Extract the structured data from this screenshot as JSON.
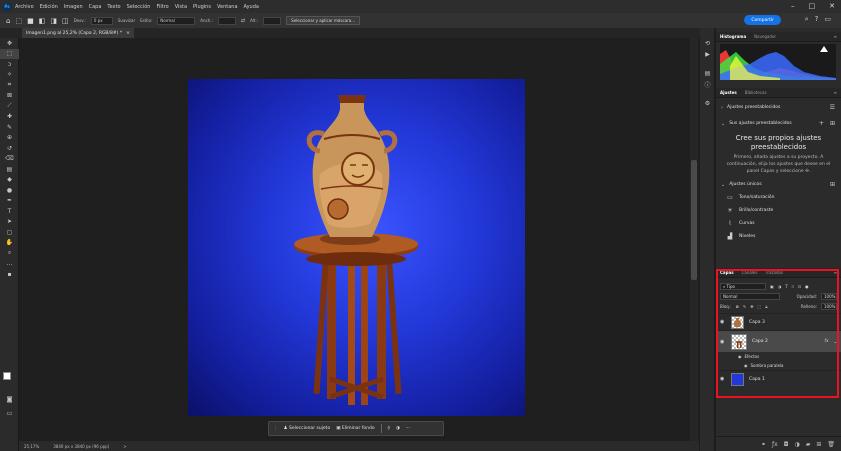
{
  "menubar": {
    "app_logo": "Ps",
    "items": [
      "Archivo",
      "Edición",
      "Imagen",
      "Capa",
      "Texto",
      "Selección",
      "Filtro",
      "Vista",
      "Plugins",
      "Ventana",
      "Ayuda"
    ],
    "window_controls": [
      "–",
      "□",
      "✕"
    ]
  },
  "optionsbar": {
    "feather_label": "Desv.:",
    "feather_value": "0 px",
    "smooth_label": "Suavizar",
    "style_label": "Estilo:",
    "style_value": "Normal",
    "width_label": "Anch.:",
    "height_label": "Alt.:",
    "select_mask_button": "Seleccionar y aplicar máscara...",
    "share_button": "Compartir"
  },
  "document": {
    "tab_title": "Imagen1.png al 25,2% (Capa 2, RGB/8#) *",
    "tab_close": "×"
  },
  "context_bar": {
    "select_subject": "Seleccionar sujeto",
    "remove_background": "Eliminar fondo",
    "more": "···"
  },
  "status": {
    "zoom": "25,17%",
    "doc_size": "3840 px x 3840 px (96 ppp)",
    "arrow": ">"
  },
  "histogram_panel": {
    "tabs": [
      "Histograma",
      "Navegador"
    ],
    "menu": "≡"
  },
  "adjustments_panel": {
    "tabs": [
      "Ajustes",
      "Bibliotecas"
    ],
    "presets_label": "Ajustes preestablecidos",
    "my_presets_label": "Sus ajustes preestablecidos",
    "empty_title": "Cree sus propios ajustes preestablecidos",
    "empty_desc": "Primero, añada ajustes a su proyecto. A continuación, elija los ajustes que desee en el panel Capas y seleccione ✣.",
    "single_adjustments_label": "Ajustes únicos",
    "items": [
      "Tono/saturación",
      "Brillo/contraste",
      "Curvas",
      "Niveles"
    ]
  },
  "layers_panel": {
    "tabs": [
      "Capas",
      "Canales",
      "Trazados"
    ],
    "filter_kind": "Tipo",
    "blend_mode": "Normal",
    "opacity_label": "Opacidad:",
    "opacity_value": "100%",
    "lock_label": "Bloq.:",
    "fill_label": "Relleno:",
    "fill_value": "100%",
    "layers": [
      {
        "name": "Capa 3",
        "selected": false
      },
      {
        "name": "Capa 2",
        "selected": true,
        "fx": "fx"
      },
      {
        "name": "Capa 1",
        "selected": false
      }
    ],
    "effects_label": "Efectos",
    "drop_shadow_label": "Sombra paralela"
  },
  "colors": {
    "accent": "#1473e6",
    "highlight": "#e8141e",
    "canvas_bg": "#1f1f1f",
    "image_bg": "#2238d8"
  }
}
